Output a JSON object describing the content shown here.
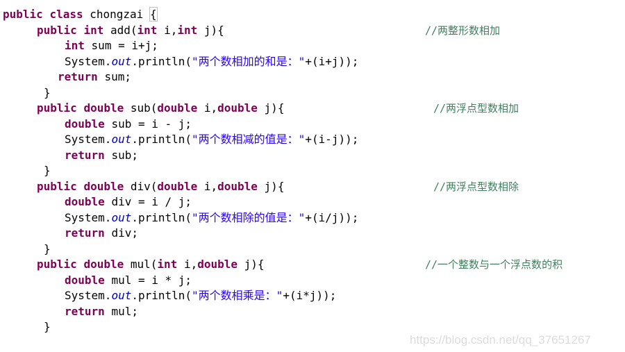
{
  "code": {
    "class_decl": {
      "kw1": "public",
      "kw2": "class",
      "name": "chongzai",
      "brace": "{"
    },
    "methods": [
      {
        "sig_kw1": "public",
        "sig_type": "int",
        "sig_name": "add(",
        "p1_type": "int",
        "p1_name": "i,",
        "p2_type": "int",
        "p2_rest": "j){",
        "comment": "//两整形数相加",
        "decl_type": "int",
        "decl_rest": "sum = i+j;",
        "print_pre": "System.",
        "print_field": "out",
        "print_mid": ".println(",
        "print_str": "\"两个数相加的和是：\"",
        "print_post": "+(i+j));",
        "ret_kw": "return",
        "ret_rest": "sum;",
        "close": "}"
      },
      {
        "sig_kw1": "public",
        "sig_type": "double",
        "sig_name": "sub(",
        "p1_type": "double",
        "p1_name": "i,",
        "p2_type": "double",
        "p2_rest": "j){",
        "comment": "//两浮点型数相加",
        "decl_type": "double",
        "decl_rest": "sub = i - j;",
        "print_pre": "System.",
        "print_field": "out",
        "print_mid": ".println(",
        "print_str": "\"两个数相减的值是：\"",
        "print_post": "+(i-j));",
        "ret_kw": "return",
        "ret_rest": "sub;",
        "close": "}"
      },
      {
        "sig_kw1": "public",
        "sig_type": "double",
        "sig_name": "div(",
        "p1_type": "double",
        "p1_name": "i,",
        "p2_type": "double",
        "p2_rest": "j){",
        "comment": "//两浮点型数相除",
        "decl_type": "double",
        "decl_rest": "div = i / j;",
        "print_pre": "System.",
        "print_field": "out",
        "print_mid": ".println(",
        "print_str": "\"两个数相除的值是：\"",
        "print_post": "+(i/j));",
        "ret_kw": "return",
        "ret_rest": "div;",
        "close": "}"
      },
      {
        "sig_kw1": "public",
        "sig_type": "double",
        "sig_name": "mul(",
        "p1_type": "int",
        "p1_name": "i,",
        "p2_type": "double",
        "p2_rest": "j){",
        "comment": "//一个整数与一个浮点数的积",
        "decl_type": "double",
        "decl_rest": "mul = i * j;",
        "print_pre": "System.",
        "print_field": "out",
        "print_mid": ".println(",
        "print_str": "\"两个数相乘是：\"",
        "print_post": "+(i*j));",
        "ret_kw": "return",
        "ret_rest": "mul;",
        "close": "}"
      }
    ]
  },
  "watermark": "https://blog.csdn.net/qq_37651267",
  "colors": {
    "keyword": "#7f0055",
    "field": "#0000c0",
    "string": "#2a00ff",
    "comment": "#3f7f5f",
    "text": "#000000",
    "background": "#ffffff"
  }
}
